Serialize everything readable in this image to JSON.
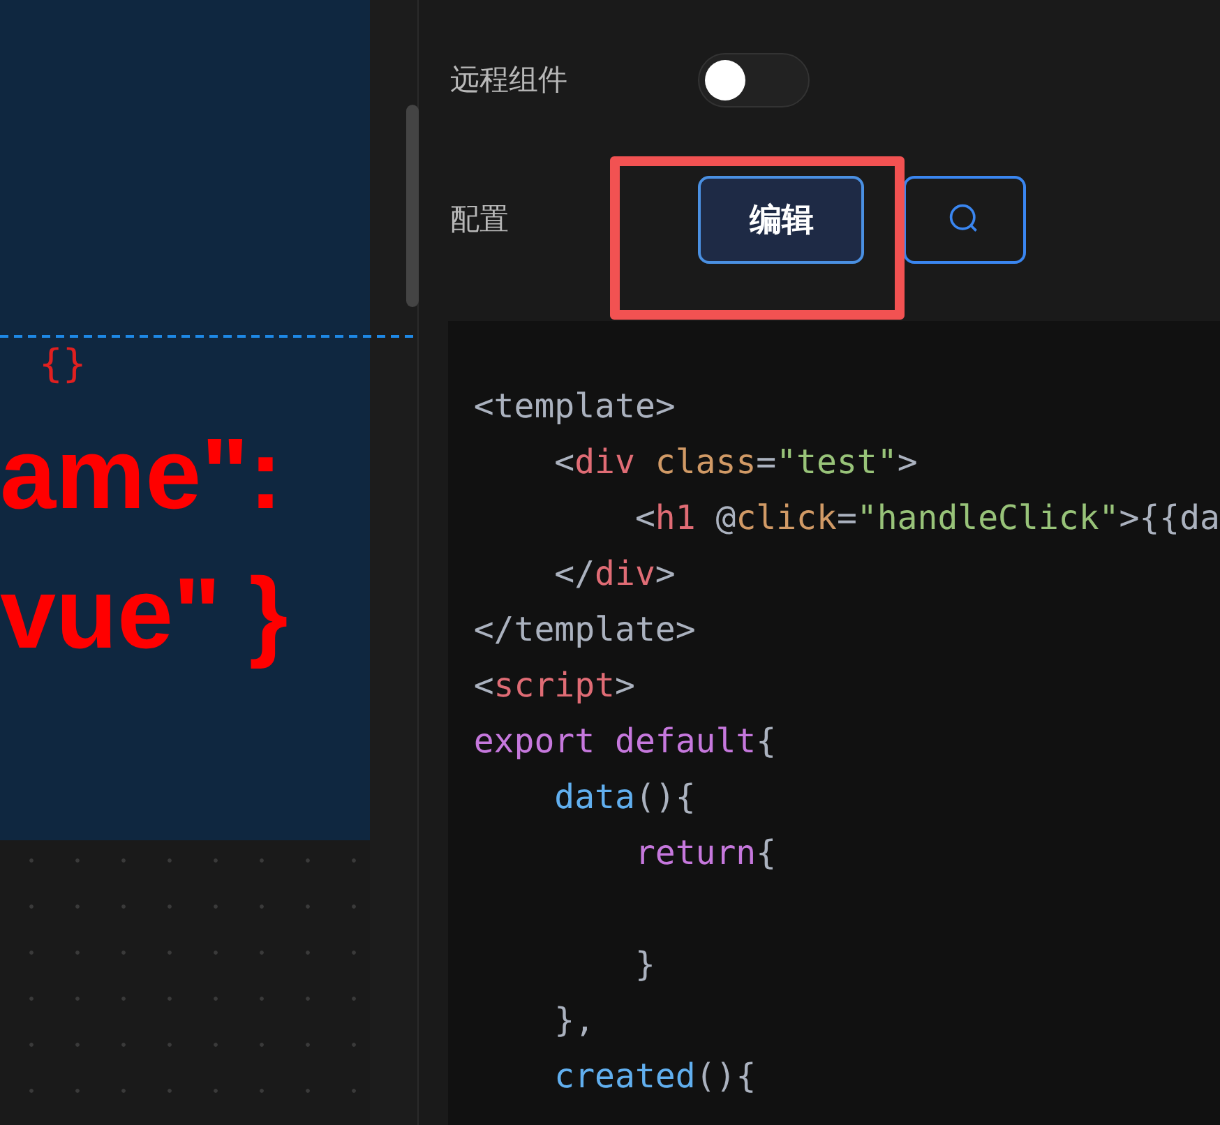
{
  "canvas": {
    "texts": [
      {
        "kind": "small",
        "text": "{}"
      },
      {
        "kind": "large",
        "text": "ame\":"
      },
      {
        "kind": "large",
        "text": "vue\" }"
      }
    ]
  },
  "settings": [
    {
      "label": "远程组件",
      "kind": "toggle",
      "on": false
    },
    {
      "label": "配置",
      "kind": "buttons",
      "buttons": [
        {
          "kind": "text",
          "label": "编辑",
          "highlighted": true
        },
        {
          "kind": "search"
        }
      ]
    }
  ],
  "code": [
    {
      "tokens": [
        {
          "kind": "punct",
          "s": "<template>"
        }
      ]
    },
    {
      "tokens": [
        {
          "kind": "punct",
          "s": "    <"
        },
        {
          "kind": "tag",
          "s": "div"
        },
        {
          "kind": "attr",
          "s": " class"
        },
        {
          "kind": "punct",
          "s": "="
        },
        {
          "kind": "string",
          "s": "\"test\""
        },
        {
          "kind": "punct",
          "s": ">"
        }
      ]
    },
    {
      "tokens": [
        {
          "kind": "punct",
          "s": "        <"
        },
        {
          "kind": "tag",
          "s": "h1"
        },
        {
          "kind": "punct",
          "s": " @"
        },
        {
          "kind": "attr",
          "s": "click"
        },
        {
          "kind": "punct",
          "s": "="
        },
        {
          "kind": "string",
          "s": "\"handleClick\""
        },
        {
          "kind": "punct",
          "s": ">{{da"
        }
      ]
    },
    {
      "tokens": [
        {
          "kind": "punct",
          "s": "    </"
        },
        {
          "kind": "tag",
          "s": "div"
        },
        {
          "kind": "punct",
          "s": ">"
        }
      ]
    },
    {
      "tokens": [
        {
          "kind": "punct",
          "s": "</template>"
        }
      ]
    },
    {
      "tokens": [
        {
          "kind": "punct",
          "s": "<"
        },
        {
          "kind": "tag",
          "s": "script"
        },
        {
          "kind": "punct",
          "s": ">"
        }
      ]
    },
    {
      "tokens": [
        {
          "kind": "keyword",
          "s": "export default"
        },
        {
          "kind": "punct",
          "s": "{"
        }
      ]
    },
    {
      "tokens": [
        {
          "kind": "function",
          "s": "    data"
        },
        {
          "kind": "punct",
          "s": "(){"
        }
      ]
    },
    {
      "tokens": [
        {
          "kind": "keyword",
          "s": "        return"
        },
        {
          "kind": "punct",
          "s": "{"
        }
      ]
    },
    {
      "kind": "blank"
    },
    {
      "tokens": [
        {
          "kind": "punct",
          "s": "        }"
        }
      ]
    },
    {
      "tokens": [
        {
          "kind": "punct",
          "s": "    },"
        }
      ]
    },
    {
      "tokens": [
        {
          "kind": "function",
          "s": "    created"
        },
        {
          "kind": "punct",
          "s": "(){"
        }
      ]
    }
  ]
}
